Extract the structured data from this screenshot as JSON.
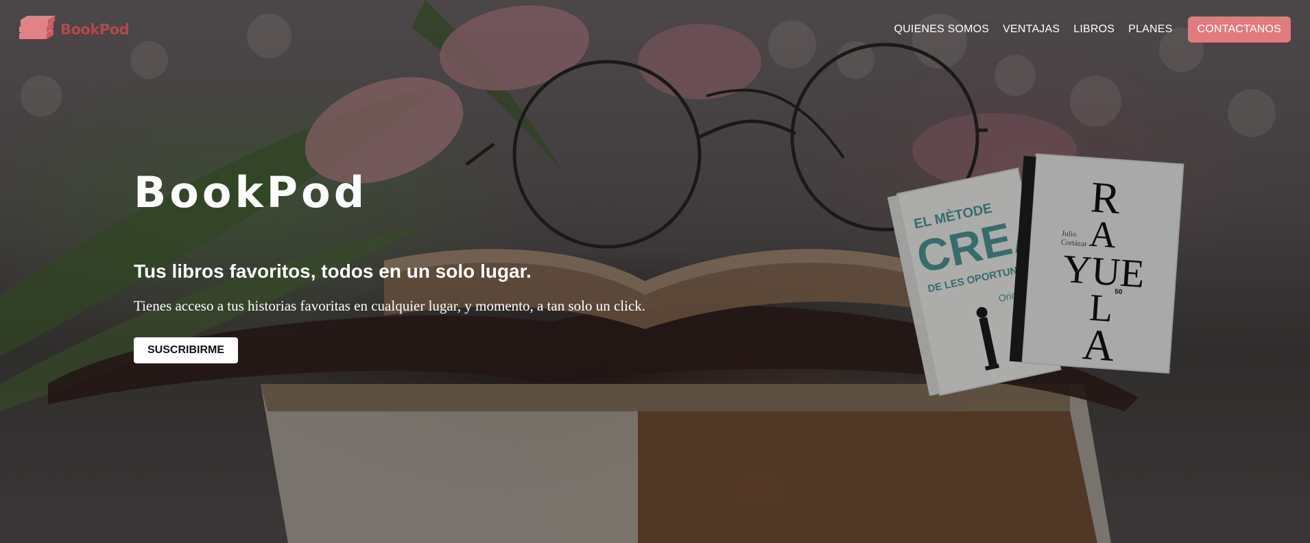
{
  "brand": {
    "name": "BookPod",
    "logo_icon": "stacked-books-icon",
    "color": "#b04a4e"
  },
  "nav": {
    "links": [
      {
        "label": "QUIENES SOMOS"
      },
      {
        "label": "VENTAJAS"
      },
      {
        "label": "LIBROS"
      },
      {
        "label": "PLANES"
      }
    ],
    "cta_label": "CONTACTANOS",
    "cta_color": "#e07c7e"
  },
  "hero": {
    "title": "BookPod",
    "subtitle": "Tus libros favoritos, todos en un solo lugar.",
    "description": "Tienes acceso a tus historias favoritas en cualquier lugar, y momento, a tan solo un click.",
    "button_label": "SUSCRIBIRME"
  },
  "books": [
    {
      "cover_lines": [
        "EL MÈTODE",
        "CREA",
        "DE LES OPORTUNITAT"
      ],
      "author": "Oriol B"
    },
    {
      "cover_lines": [
        "R",
        "A",
        "YUE",
        "L",
        "A"
      ],
      "author_lines": [
        "Julio",
        "Cortázar"
      ],
      "badge": "50"
    }
  ]
}
